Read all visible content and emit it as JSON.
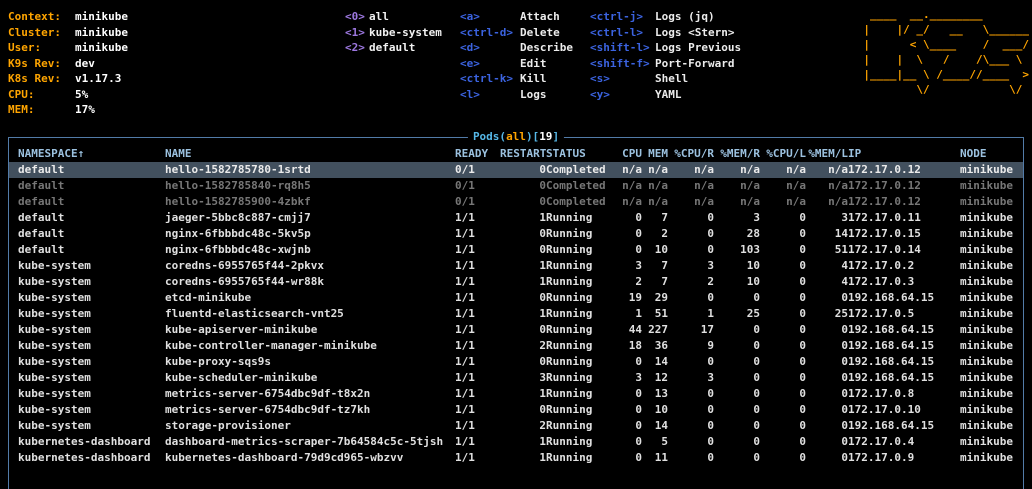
{
  "colors": {
    "orange": "#ffa500",
    "purple_key": "#9d78e0",
    "blue_key": "#3b63e0",
    "border_blue": "#527ba8",
    "header_text": "#9cc2e0",
    "title_aqua": "#56b8e8",
    "row_running": "#e0e0e0",
    "row_completed": "#777777",
    "selected_bg": "#42505e"
  },
  "cluster_info": [
    {
      "label": "Context:",
      "value": "minikube"
    },
    {
      "label": "Cluster:",
      "value": "minikube"
    },
    {
      "label": "User:",
      "value": "minikube"
    },
    {
      "label": "K9s Rev:",
      "value": "dev"
    },
    {
      "label": "K8s Rev:",
      "value": "v1.17.3"
    },
    {
      "label": "CPU:",
      "value": "5%"
    },
    {
      "label": "MEM:",
      "value": "17%"
    }
  ],
  "namespace_hotkeys": [
    {
      "key": "<0>",
      "label": "all"
    },
    {
      "key": "<1>",
      "label": "kube-system"
    },
    {
      "key": "<2>",
      "label": "default"
    }
  ],
  "menu_col1": [
    {
      "key": "<a>",
      "label": "Attach"
    },
    {
      "key": "<ctrl-d>",
      "label": "Delete"
    },
    {
      "key": "<d>",
      "label": "Describe"
    },
    {
      "key": "<e>",
      "label": "Edit"
    },
    {
      "key": "<ctrl-k>",
      "label": "Kill"
    },
    {
      "key": "<l>",
      "label": "Logs"
    }
  ],
  "menu_col2": [
    {
      "key": "<ctrl-j>",
      "label": "Logs (jq)"
    },
    {
      "key": "<ctrl-l>",
      "label": "Logs <Stern>"
    },
    {
      "key": "<shift-l>",
      "label": "Logs Previous"
    },
    {
      "key": "<shift-f>",
      "label": "Port-Forward"
    },
    {
      "key": "<s>",
      "label": "Shell"
    },
    {
      "key": "<y>",
      "label": "YAML"
    }
  ],
  "logo_lines": [
    " ____  __.________       ",
    "|    |/ _/   __   \\______",
    "|      < \\____    /  ___/",
    "|    |  \\   /    /\\___ \\ ",
    "|____|__ \\ /____//____  >",
    "        \\/            \\/ "
  ],
  "table": {
    "title": {
      "prefix": "Pods(",
      "namespace": "all",
      "mid": ")[",
      "count": "19",
      "suffix": "]"
    },
    "headers": [
      "NAMESPACE↑",
      "NAME",
      "READY",
      "RESTART",
      "STATUS",
      "CPU",
      "MEM",
      "%CPU/R",
      "%MEM/R",
      "%CPU/L",
      "%MEM/L",
      "IP",
      "NODE"
    ],
    "rows": [
      {
        "state": "selected",
        "cells": [
          "default",
          "hello-1582785780-1srtd",
          "0/1",
          "0",
          "Completed",
          "n/a",
          "n/a",
          "n/a",
          "n/a",
          "n/a",
          "n/a",
          "172.17.0.12",
          "minikube"
        ]
      },
      {
        "state": "completed",
        "cells": [
          "default",
          "hello-1582785840-rq8h5",
          "0/1",
          "0",
          "Completed",
          "n/a",
          "n/a",
          "n/a",
          "n/a",
          "n/a",
          "n/a",
          "172.17.0.12",
          "minikube"
        ]
      },
      {
        "state": "completed",
        "cells": [
          "default",
          "hello-1582785900-4zbkf",
          "0/1",
          "0",
          "Completed",
          "n/a",
          "n/a",
          "n/a",
          "n/a",
          "n/a",
          "n/a",
          "172.17.0.12",
          "minikube"
        ]
      },
      {
        "state": "running",
        "cells": [
          "default",
          "jaeger-5bbc8c887-cmjj7",
          "1/1",
          "1",
          "Running",
          "0",
          "7",
          "0",
          "3",
          "0",
          "3",
          "172.17.0.11",
          "minikube"
        ]
      },
      {
        "state": "running",
        "cells": [
          "default",
          "nginx-6fbbbdc48c-5kv5p",
          "1/1",
          "0",
          "Running",
          "0",
          "2",
          "0",
          "28",
          "0",
          "14",
          "172.17.0.15",
          "minikube"
        ]
      },
      {
        "state": "running",
        "cells": [
          "default",
          "nginx-6fbbbdc48c-xwjnb",
          "1/1",
          "0",
          "Running",
          "0",
          "10",
          "0",
          "103",
          "0",
          "51",
          "172.17.0.14",
          "minikube"
        ]
      },
      {
        "state": "running",
        "cells": [
          "kube-system",
          "coredns-6955765f44-2pkvx",
          "1/1",
          "1",
          "Running",
          "3",
          "7",
          "3",
          "10",
          "0",
          "4",
          "172.17.0.2",
          "minikube"
        ]
      },
      {
        "state": "running",
        "cells": [
          "kube-system",
          "coredns-6955765f44-wr88k",
          "1/1",
          "1",
          "Running",
          "2",
          "7",
          "2",
          "10",
          "0",
          "4",
          "172.17.0.3",
          "minikube"
        ]
      },
      {
        "state": "running",
        "cells": [
          "kube-system",
          "etcd-minikube",
          "1/1",
          "0",
          "Running",
          "19",
          "29",
          "0",
          "0",
          "0",
          "0",
          "192.168.64.15",
          "minikube"
        ]
      },
      {
        "state": "running",
        "cells": [
          "kube-system",
          "fluentd-elasticsearch-vnt25",
          "1/1",
          "1",
          "Running",
          "1",
          "51",
          "1",
          "25",
          "0",
          "25",
          "172.17.0.5",
          "minikube"
        ]
      },
      {
        "state": "running",
        "cells": [
          "kube-system",
          "kube-apiserver-minikube",
          "1/1",
          "0",
          "Running",
          "44",
          "227",
          "17",
          "0",
          "0",
          "0",
          "192.168.64.15",
          "minikube"
        ]
      },
      {
        "state": "running",
        "cells": [
          "kube-system",
          "kube-controller-manager-minikube",
          "1/1",
          "2",
          "Running",
          "18",
          "36",
          "9",
          "0",
          "0",
          "0",
          "192.168.64.15",
          "minikube"
        ]
      },
      {
        "state": "running",
        "cells": [
          "kube-system",
          "kube-proxy-sqs9s",
          "1/1",
          "0",
          "Running",
          "0",
          "14",
          "0",
          "0",
          "0",
          "0",
          "192.168.64.15",
          "minikube"
        ]
      },
      {
        "state": "running",
        "cells": [
          "kube-system",
          "kube-scheduler-minikube",
          "1/1",
          "3",
          "Running",
          "3",
          "12",
          "3",
          "0",
          "0",
          "0",
          "192.168.64.15",
          "minikube"
        ]
      },
      {
        "state": "running",
        "cells": [
          "kube-system",
          "metrics-server-6754dbc9df-t8x2n",
          "1/1",
          "1",
          "Running",
          "0",
          "13",
          "0",
          "0",
          "0",
          "0",
          "172.17.0.8",
          "minikube"
        ]
      },
      {
        "state": "running",
        "cells": [
          "kube-system",
          "metrics-server-6754dbc9df-tz7kh",
          "1/1",
          "0",
          "Running",
          "0",
          "10",
          "0",
          "0",
          "0",
          "0",
          "172.17.0.10",
          "minikube"
        ]
      },
      {
        "state": "running",
        "cells": [
          "kube-system",
          "storage-provisioner",
          "1/1",
          "2",
          "Running",
          "0",
          "14",
          "0",
          "0",
          "0",
          "0",
          "192.168.64.15",
          "minikube"
        ]
      },
      {
        "state": "running",
        "cells": [
          "kubernetes-dashboard",
          "dashboard-metrics-scraper-7b64584c5c-5tjsh",
          "1/1",
          "1",
          "Running",
          "0",
          "5",
          "0",
          "0",
          "0",
          "0",
          "172.17.0.4",
          "minikube"
        ]
      },
      {
        "state": "running",
        "cells": [
          "kubernetes-dashboard",
          "kubernetes-dashboard-79d9cd965-wbzvv",
          "1/1",
          "1",
          "Running",
          "0",
          "11",
          "0",
          "0",
          "0",
          "0",
          "172.17.0.9",
          "minikube"
        ]
      }
    ]
  }
}
